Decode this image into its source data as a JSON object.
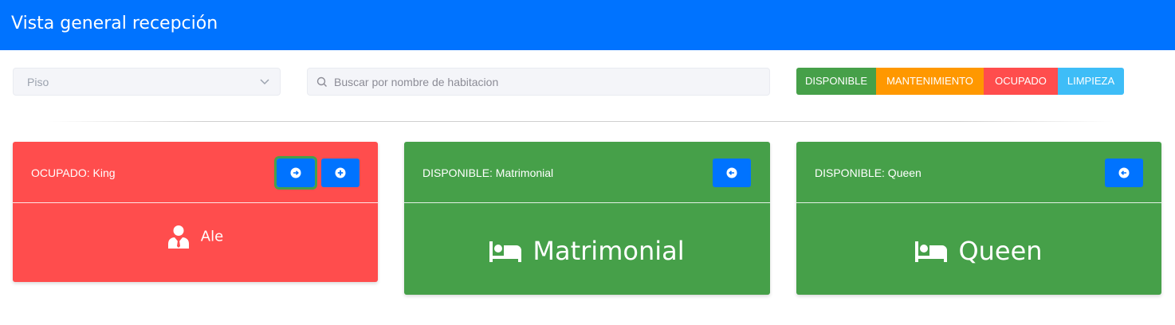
{
  "header": {
    "title": "Vista general recepción"
  },
  "filters": {
    "floor_select": {
      "value": "Piso"
    },
    "search": {
      "placeholder": "Buscar por nombre de habitacion"
    }
  },
  "legend": [
    {
      "label": "DISPONIBLE",
      "color": "#46a049"
    },
    {
      "label": "MANTENIMIENTO",
      "color": "#ff9800"
    },
    {
      "label": "OCUPADO",
      "color": "#ff4d4d"
    },
    {
      "label": "LIMPIEZA",
      "color": "#3ebdf7"
    }
  ],
  "rooms": [
    {
      "status_label": "OCUPADO: King",
      "status_color": "#ff4d4d",
      "guest_name": "Ale",
      "icon": "user-tie-icon",
      "actions": [
        "arrow-right-icon",
        "plus-circle-icon"
      ]
    },
    {
      "status_label": "DISPONIBLE: Matrimonial",
      "status_color": "#46a049",
      "room_type": "Matrimonial",
      "icon": "bed-icon",
      "actions": [
        "arrow-left-icon"
      ]
    },
    {
      "status_label": "DISPONIBLE: Queen",
      "status_color": "#46a049",
      "room_type": "Queen",
      "icon": "bed-icon",
      "actions": [
        "arrow-left-icon"
      ]
    }
  ],
  "colors": {
    "header_bg": "#0073ff",
    "button_bg": "#0073ff"
  }
}
